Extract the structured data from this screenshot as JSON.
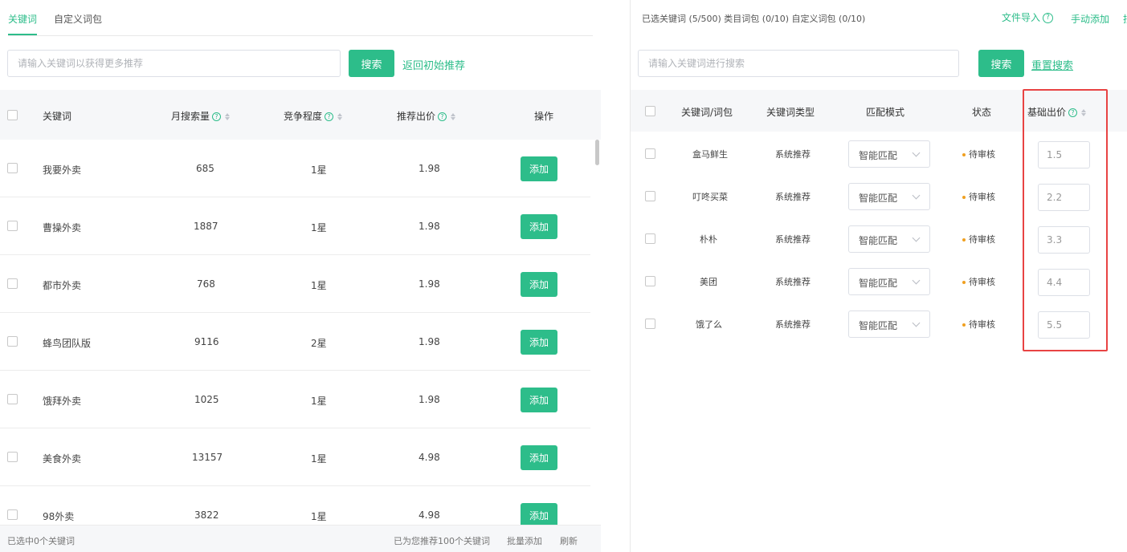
{
  "left": {
    "tabs": [
      {
        "label": "关键词",
        "active": true
      },
      {
        "label": "自定义词包",
        "active": false
      }
    ],
    "search": {
      "placeholder": "请输入关键词以获得更多推荐",
      "value": "",
      "button": "搜索",
      "reset": "返回初始推荐"
    },
    "columns": {
      "keyword": "关键词",
      "monthly": "月搜索量",
      "competition": "竞争程度",
      "bid": "推荐出价",
      "action": "操作"
    },
    "add_label": "添加",
    "rows": [
      {
        "keyword": "我要外卖",
        "monthly": "685",
        "competition": "1星",
        "bid": "1.98"
      },
      {
        "keyword": "曹操外卖",
        "monthly": "1887",
        "competition": "1星",
        "bid": "1.98"
      },
      {
        "keyword": "都市外卖",
        "monthly": "768",
        "competition": "1星",
        "bid": "1.98"
      },
      {
        "keyword": "蜂鸟团队版",
        "monthly": "9116",
        "competition": "2星",
        "bid": "1.98"
      },
      {
        "keyword": "饿拜外卖",
        "monthly": "1025",
        "competition": "1星",
        "bid": "1.98"
      },
      {
        "keyword": "美食外卖",
        "monthly": "13157",
        "competition": "1星",
        "bid": "4.98"
      },
      {
        "keyword": "98外卖",
        "monthly": "3822",
        "competition": "1星",
        "bid": "4.98"
      }
    ],
    "footer": {
      "selected": "已选中0个关键词",
      "recommended": "已为您推荐100个关键词",
      "batch_add": "批量添加",
      "refresh": "刷新"
    }
  },
  "right": {
    "info": "已选关键词 (5/500) 类目词包 (0/10) 自定义词包 (0/10)",
    "file_import": "文件导入",
    "manual_add": "手动添加",
    "more": "批",
    "search": {
      "placeholder": "请输入关键词进行搜索",
      "value": "",
      "button": "搜索",
      "reset": "重置搜索"
    },
    "columns": {
      "keyword": "关键词/词包",
      "type": "关键词类型",
      "match": "匹配模式",
      "status": "状态",
      "base_bid": "基础出价"
    },
    "rows": [
      {
        "keyword": "盒马鲜生",
        "type": "系统推荐",
        "match": "智能匹配",
        "status": "待审核",
        "base_bid": "1.5"
      },
      {
        "keyword": "叮咚买菜",
        "type": "系统推荐",
        "match": "智能匹配",
        "status": "待审核",
        "base_bid": "2.2"
      },
      {
        "keyword": "朴朴",
        "type": "系统推荐",
        "match": "智能匹配",
        "status": "待审核",
        "base_bid": "3.3"
      },
      {
        "keyword": "美团",
        "type": "系统推荐",
        "match": "智能匹配",
        "status": "待审核",
        "base_bid": "4.4"
      },
      {
        "keyword": "饿了么",
        "type": "系统推荐",
        "match": "智能匹配",
        "status": "待审核",
        "base_bid": "5.5"
      }
    ]
  },
  "help_glyph": "?",
  "colors": {
    "accent": "#2dbd8a",
    "highlight": "#e84343",
    "pending": "#f0a020"
  }
}
